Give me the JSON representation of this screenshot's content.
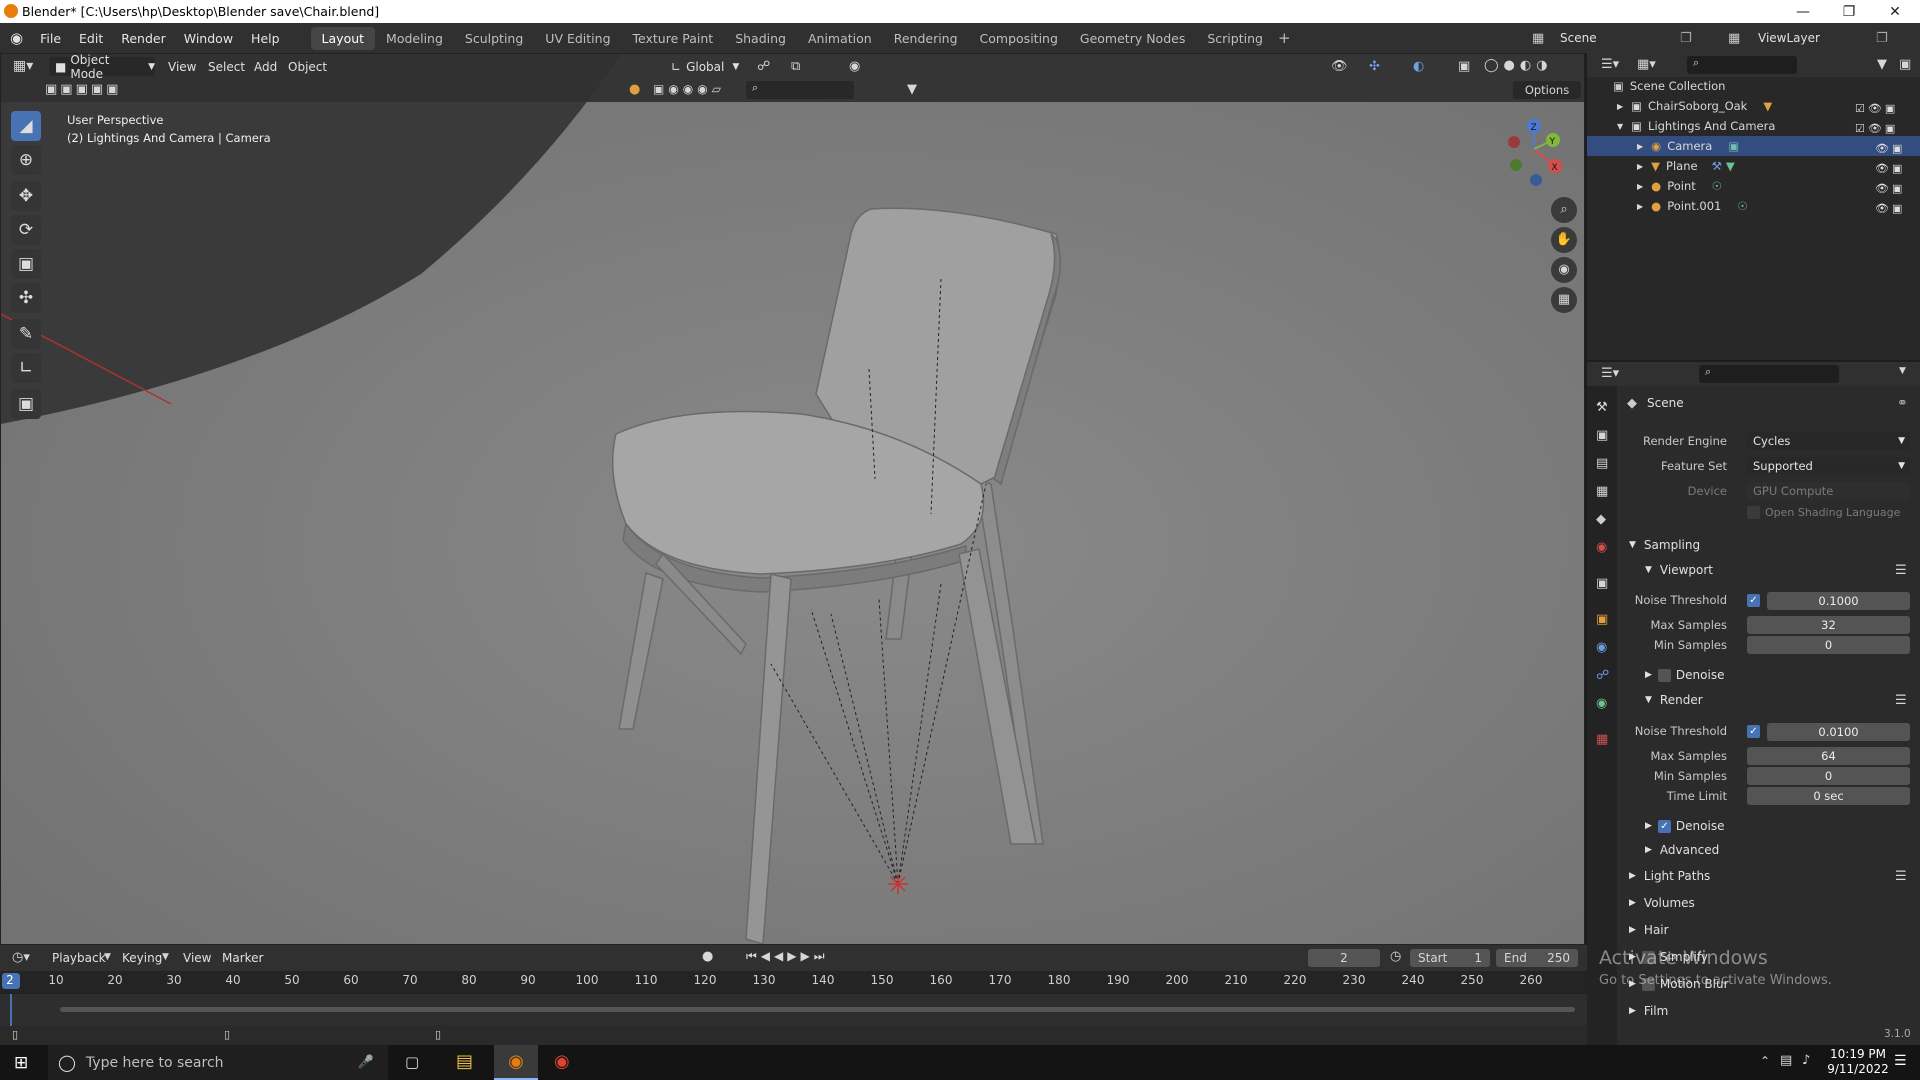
{
  "window": {
    "title": "Blender* [C:\\Users\\hp\\Desktop\\Blender save\\Chair.blend]"
  },
  "menu": [
    "File",
    "Edit",
    "Render",
    "Window",
    "Help"
  ],
  "workspaces": [
    "Layout",
    "Modeling",
    "Sculpting",
    "UV Editing",
    "Texture Paint",
    "Shading",
    "Animation",
    "Rendering",
    "Compositing",
    "Geometry Nodes",
    "Scripting"
  ],
  "active_workspace": "Layout",
  "scene": "Scene",
  "view_layer": "ViewLayer",
  "viewport": {
    "mode": "Object Mode",
    "menus": [
      "View",
      "Select",
      "Add",
      "Object"
    ],
    "transform": "Global",
    "options": "Options",
    "overlay_line1": "User Perspective",
    "overlay_line2": "(2) Lightings And Camera | Camera",
    "tools": [
      "select-box-icon",
      "cursor-icon",
      "move-icon",
      "rotate-icon",
      "scale-icon",
      "transform-icon",
      "annotate-icon",
      "measure-icon",
      "add-cube-icon"
    ]
  },
  "outliner": {
    "root": "Scene Collection",
    "items": [
      {
        "label": "ChairSoborg_Oak",
        "indent": 1
      },
      {
        "label": "Lightings And Camera",
        "indent": 1
      },
      {
        "label": "Camera",
        "indent": 2,
        "selected": true
      },
      {
        "label": "Plane",
        "indent": 2
      },
      {
        "label": "Point",
        "indent": 2
      },
      {
        "label": "Point.001",
        "indent": 2
      }
    ]
  },
  "properties": {
    "context": "Scene",
    "render_engine_label": "Render Engine",
    "render_engine": "Cycles",
    "feature_set_label": "Feature Set",
    "feature_set": "Supported",
    "device_label": "Device",
    "device": "GPU Compute",
    "osl": "Open Shading Language",
    "sampling": "Sampling",
    "viewport": "Viewport",
    "noise_threshold_label": "Noise Threshold",
    "vp_noise_threshold": "0.1000",
    "max_samples_label": "Max Samples",
    "vp_max_samples": "32",
    "min_samples_label": "Min Samples",
    "vp_min_samples": "0",
    "denoise": "Denoise",
    "render": "Render",
    "r_noise_threshold": "0.0100",
    "r_max_samples": "64",
    "r_min_samples": "0",
    "time_limit_label": "Time Limit",
    "time_limit": "0 sec",
    "advanced": "Advanced",
    "light_paths": "Light Paths",
    "volumes": "Volumes",
    "hair": "Hair",
    "simplify": "Simplify",
    "motion_blur": "Motion Blur",
    "film": "Film"
  },
  "timeline": {
    "menus": [
      "Playback",
      "Keying",
      "View",
      "Marker"
    ],
    "current_frame": "2",
    "start_label": "Start",
    "start": "1",
    "end_label": "End",
    "end": "250",
    "frame_numbers": [
      "2",
      "10",
      "20",
      "30",
      "40",
      "50",
      "60",
      "70",
      "80",
      "90",
      "100",
      "110",
      "120",
      "130",
      "140",
      "150",
      "160",
      "170",
      "180",
      "190",
      "200",
      "210",
      "220",
      "230",
      "240",
      "250",
      "260"
    ]
  },
  "status": {
    "version": "3.1.0"
  },
  "watermark": {
    "line1": "Activate Windows",
    "line2": "Go to Settings to activate Windows."
  },
  "taskbar": {
    "search_placeholder": "Type here to search",
    "time": "10:19 PM",
    "date": "9/11/2022"
  }
}
